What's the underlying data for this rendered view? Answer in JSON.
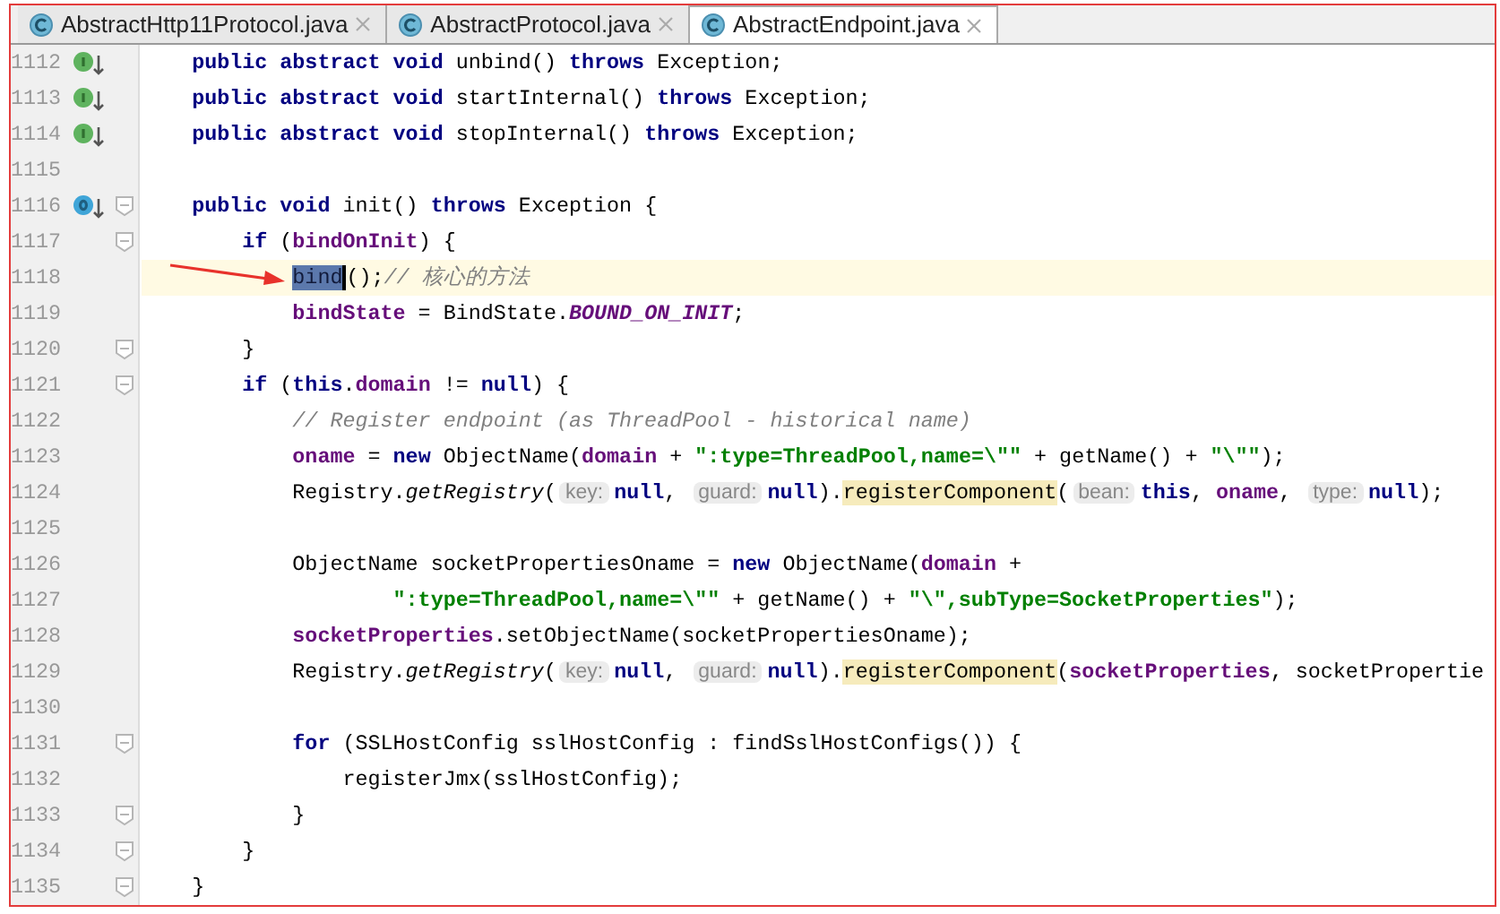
{
  "tabs": [
    {
      "label": "AbstractHttp11Protocol.java",
      "selected": false
    },
    {
      "label": "AbstractProtocol.java",
      "selected": false
    },
    {
      "label": "AbstractEndpoint.java",
      "selected": true
    }
  ],
  "lines": [
    {
      "number": "1112",
      "gutter_marker": {
        "kind": "implements"
      },
      "fold": false,
      "current": false,
      "tokens": [
        {
          "kind": "kw",
          "text": "    public abstract void"
        },
        {
          "kind": "plain",
          "text": " unbind() "
        },
        {
          "kind": "kw",
          "text": "throws"
        },
        {
          "kind": "plain",
          "text": " Exception;"
        }
      ]
    },
    {
      "number": "1113",
      "gutter_marker": {
        "kind": "implements"
      },
      "fold": false,
      "current": false,
      "tokens": [
        {
          "kind": "kw",
          "text": "    public abstract void"
        },
        {
          "kind": "plain",
          "text": " startInternal() "
        },
        {
          "kind": "kw",
          "text": "throws"
        },
        {
          "kind": "plain",
          "text": " Exception;"
        }
      ]
    },
    {
      "number": "1114",
      "gutter_marker": {
        "kind": "implements"
      },
      "fold": false,
      "current": false,
      "tokens": [
        {
          "kind": "kw",
          "text": "    public abstract void"
        },
        {
          "kind": "plain",
          "text": " stopInternal() "
        },
        {
          "kind": "kw",
          "text": "throws"
        },
        {
          "kind": "plain",
          "text": " Exception;"
        }
      ]
    },
    {
      "number": "1115",
      "fold": false,
      "current": false
    },
    {
      "number": "1116",
      "gutter_marker": {
        "kind": "overrides"
      },
      "fold": true,
      "current": false,
      "tokens": [
        {
          "kind": "kw",
          "text": "    public void"
        },
        {
          "kind": "plain",
          "text": " init() "
        },
        {
          "kind": "kw",
          "text": "throws"
        },
        {
          "kind": "plain",
          "text": " Exception {"
        }
      ]
    },
    {
      "number": "1117",
      "fold": true,
      "current": false,
      "tokens": [
        {
          "kind": "kw",
          "text": "        if"
        },
        {
          "kind": "plain",
          "text": " ("
        },
        {
          "kind": "field",
          "text": "bindOnInit"
        },
        {
          "kind": "plain",
          "text": ") {"
        }
      ]
    },
    {
      "number": "1118",
      "fold": false,
      "current": true,
      "tokens": [
        {
          "kind": "selection",
          "text": "            bind"
        },
        {
          "kind": "plain",
          "text": "();"
        },
        {
          "kind": "comment",
          "text": "// 核心的方法"
        }
      ]
    },
    {
      "number": "1119",
      "fold": false,
      "current": false,
      "tokens": [
        {
          "kind": "field",
          "text": "            bindState"
        },
        {
          "kind": "plain",
          "text": " = BindState."
        },
        {
          "kind": "static",
          "text": "BOUND_ON_INIT"
        },
        {
          "kind": "plain",
          "text": ";"
        }
      ]
    },
    {
      "number": "1120",
      "fold": true,
      "current": false,
      "tokens": [
        {
          "kind": "plain",
          "text": "        }"
        }
      ]
    },
    {
      "number": "1121",
      "fold": true,
      "current": false,
      "tokens": [
        {
          "kind": "kw",
          "text": "        if"
        },
        {
          "kind": "plain",
          "text": " ("
        },
        {
          "kind": "kw",
          "text": "this"
        },
        {
          "kind": "plain",
          "text": "."
        },
        {
          "kind": "field",
          "text": "domain"
        },
        {
          "kind": "plain",
          "text": " != "
        },
        {
          "kind": "kw",
          "text": "null"
        },
        {
          "kind": "plain",
          "text": ") {"
        }
      ]
    },
    {
      "number": "1122",
      "fold": false,
      "current": false,
      "tokens": [
        {
          "kind": "comment",
          "text": "            // Register endpoint (as ThreadPool - historical name)"
        }
      ]
    },
    {
      "number": "1123",
      "fold": false,
      "current": false,
      "tokens": [
        {
          "kind": "field",
          "text": "            oname"
        },
        {
          "kind": "plain",
          "text": " = "
        },
        {
          "kind": "kw",
          "text": "new"
        },
        {
          "kind": "plain",
          "text": " ObjectName("
        },
        {
          "kind": "field",
          "text": "domain"
        },
        {
          "kind": "plain",
          "text": " + "
        },
        {
          "kind": "str",
          "text": "\":type=ThreadPool,name=\\\"\""
        },
        {
          "kind": "plain",
          "text": " + getName() + "
        },
        {
          "kind": "str",
          "text": "\"\\\"\""
        },
        {
          "kind": "plain",
          "text": ");"
        }
      ]
    },
    {
      "number": "1124",
      "fold": false,
      "current": false,
      "tokens": [
        {
          "kind": "plain",
          "text": "            Registry."
        },
        {
          "kind": "italic",
          "text": "getRegistry"
        },
        {
          "kind": "plain",
          "text": "("
        },
        {
          "kind": "hint",
          "text": "key:"
        },
        {
          "kind": "kw",
          "text": "null"
        },
        {
          "kind": "plain",
          "text": ", "
        },
        {
          "kind": "hint",
          "text": "guard:"
        },
        {
          "kind": "kw",
          "text": "null"
        },
        {
          "kind": "plain",
          "text": ")."
        },
        {
          "kind": "match",
          "text": "registerComponent"
        },
        {
          "kind": "plain",
          "text": "("
        },
        {
          "kind": "hint",
          "text": "bean:"
        },
        {
          "kind": "kw",
          "text": "this"
        },
        {
          "kind": "plain",
          "text": ", "
        },
        {
          "kind": "field",
          "text": "oname"
        },
        {
          "kind": "plain",
          "text": ", "
        },
        {
          "kind": "hint",
          "text": "type:"
        },
        {
          "kind": "kw",
          "text": "null"
        },
        {
          "kind": "plain",
          "text": ");"
        }
      ]
    },
    {
      "number": "1125",
      "fold": false,
      "current": false
    },
    {
      "number": "1126",
      "fold": false,
      "current": false,
      "tokens": [
        {
          "kind": "plain",
          "text": "            ObjectName socketPropertiesOname = "
        },
        {
          "kind": "kw",
          "text": "new"
        },
        {
          "kind": "plain",
          "text": " ObjectName("
        },
        {
          "kind": "field",
          "text": "domain"
        },
        {
          "kind": "plain",
          "text": " +"
        }
      ]
    },
    {
      "number": "1127",
      "fold": false,
      "current": false,
      "tokens": [
        {
          "kind": "str",
          "text": "                    \":type=ThreadPool,name=\\\"\""
        },
        {
          "kind": "plain",
          "text": " + getName() + "
        },
        {
          "kind": "str",
          "text": "\"\\\",subType=SocketProperties\""
        },
        {
          "kind": "plain",
          "text": ");"
        }
      ]
    },
    {
      "number": "1128",
      "fold": false,
      "current": false,
      "tokens": [
        {
          "kind": "field",
          "text": "            socketProperties"
        },
        {
          "kind": "plain",
          "text": ".setObjectName(socketPropertiesOname);"
        }
      ]
    },
    {
      "number": "1129",
      "fold": false,
      "current": false,
      "tokens": [
        {
          "kind": "plain",
          "text": "            Registry."
        },
        {
          "kind": "italic",
          "text": "getRegistry"
        },
        {
          "kind": "plain",
          "text": "("
        },
        {
          "kind": "hint",
          "text": "key:"
        },
        {
          "kind": "kw",
          "text": "null"
        },
        {
          "kind": "plain",
          "text": ", "
        },
        {
          "kind": "hint",
          "text": "guard:"
        },
        {
          "kind": "kw",
          "text": "null"
        },
        {
          "kind": "plain",
          "text": ")."
        },
        {
          "kind": "match",
          "text": "registerComponent"
        },
        {
          "kind": "plain",
          "text": "("
        },
        {
          "kind": "field",
          "text": "socketProperties"
        },
        {
          "kind": "plain",
          "text": ", socketPropertie"
        }
      ]
    },
    {
      "number": "1130",
      "fold": false,
      "current": false
    },
    {
      "number": "1131",
      "fold": true,
      "current": false,
      "tokens": [
        {
          "kind": "kw",
          "text": "            for"
        },
        {
          "kind": "plain",
          "text": " (SSLHostConfig sslHostConfig : findSslHostConfigs()) {"
        }
      ]
    },
    {
      "number": "1132",
      "fold": false,
      "current": false,
      "tokens": [
        {
          "kind": "plain",
          "text": "                registerJmx(sslHostConfig);"
        }
      ]
    },
    {
      "number": "1133",
      "fold": true,
      "current": false,
      "tokens": [
        {
          "kind": "plain",
          "text": "            }"
        }
      ]
    },
    {
      "number": "1134",
      "fold": true,
      "current": false,
      "tokens": [
        {
          "kind": "plain",
          "text": "        }"
        }
      ]
    },
    {
      "number": "1135",
      "fold": true,
      "current": false,
      "tokens": [
        {
          "kind": "plain",
          "text": "    }"
        }
      ]
    }
  ]
}
